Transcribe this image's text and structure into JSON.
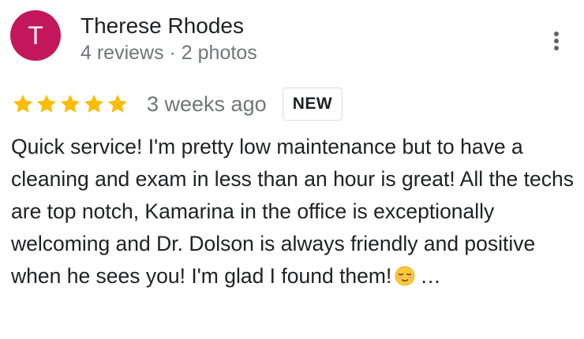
{
  "reviewer": {
    "initial": "T",
    "name": "Therese Rhodes",
    "meta": "4 reviews · 2 photos",
    "avatar_color": "#c2185b"
  },
  "menu": {
    "icon": "more-vert-icon"
  },
  "rating": {
    "stars": 5,
    "max": 5,
    "star_color": "#fbbc04",
    "time": "3 weeks ago",
    "badge": "NEW"
  },
  "review": {
    "text": "Quick service! I'm pretty low maintenance but to have a cleaning  and exam in less than an hour is great! All the techs are top notch, Kamarina in the office is exceptionally welcoming and Dr. Dolson is always friendly and positive when he sees you! I'm glad I found them!",
    "emoji": "relieved-face-emoji",
    "truncation": "…"
  }
}
